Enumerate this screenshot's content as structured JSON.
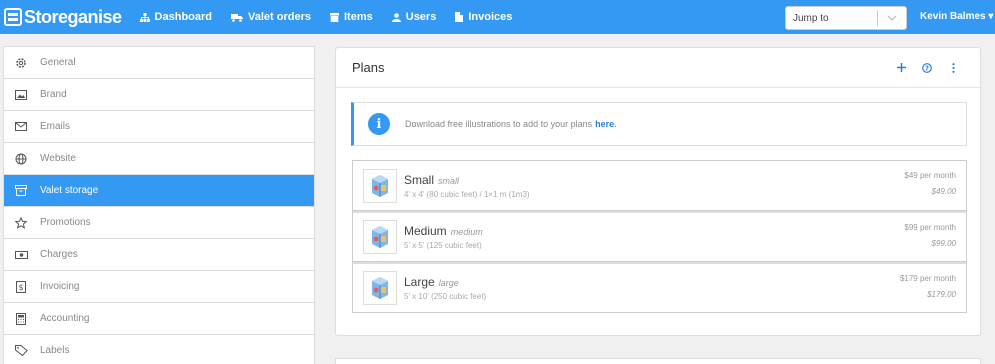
{
  "brand": {
    "name": "Storeganise"
  },
  "nav": [
    {
      "label": "Dashboard",
      "icon": "sitemap-icon"
    },
    {
      "label": "Valet orders",
      "icon": "truck-icon"
    },
    {
      "label": "Items",
      "icon": "box-icon"
    },
    {
      "label": "Users",
      "icon": "user-icon"
    },
    {
      "label": "Invoices",
      "icon": "file-icon"
    }
  ],
  "jump": {
    "placeholder": "Jump to"
  },
  "user": {
    "name": "Kevin Balmes ▾"
  },
  "sidebar": {
    "items": [
      {
        "label": "General",
        "icon": "gear-icon"
      },
      {
        "label": "Brand",
        "icon": "image-icon"
      },
      {
        "label": "Emails",
        "icon": "envelope-icon"
      },
      {
        "label": "Website",
        "icon": "globe-icon"
      },
      {
        "label": "Valet storage",
        "icon": "archive-icon",
        "active": true
      },
      {
        "label": "Promotions",
        "icon": "star-icon"
      },
      {
        "label": "Charges",
        "icon": "money-icon"
      },
      {
        "label": "Invoicing",
        "icon": "dollar-doc-icon"
      },
      {
        "label": "Accounting",
        "icon": "calculator-icon"
      },
      {
        "label": "Labels",
        "icon": "tag-icon"
      }
    ]
  },
  "panel": {
    "title": "Plans",
    "info_text": "Download free illustrations to add to your plans",
    "info_link": "here",
    "info_suffix": "."
  },
  "plans": [
    {
      "name": "Small",
      "code": "small",
      "desc": "4' x 4' (80 cubic feet) / 1×1 m (1m3)",
      "price": "$49 per month",
      "price2": "$49.00"
    },
    {
      "name": "Medium",
      "code": "medium",
      "desc": "5' x 5' (125 cubic feet)",
      "price": "$99 per month",
      "price2": "$99.00"
    },
    {
      "name": "Large",
      "code": "large",
      "desc": "5' x 10' (250 cubic feet)",
      "price": "$179 per month",
      "price2": "$179.00"
    }
  ],
  "colors": {
    "primary": "#3399f3",
    "active_sidebar": "#3399f3",
    "link": "#2a7fd4"
  }
}
